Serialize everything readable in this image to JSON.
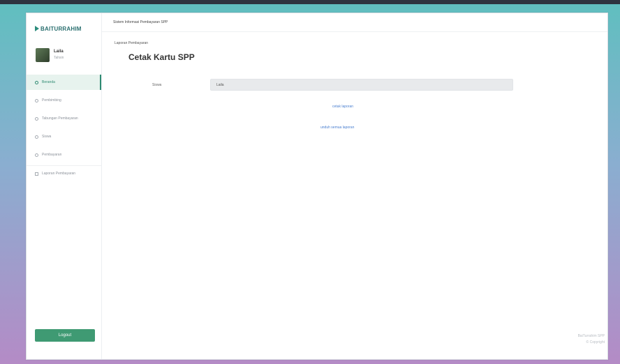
{
  "brand": {
    "name": "BAITURRAHIM"
  },
  "profile": {
    "name": "Laila",
    "role": "Tahsin"
  },
  "sidebar": {
    "items": [
      {
        "label": "Beranda",
        "icon": "home-icon"
      },
      {
        "label": "Pembimbing",
        "icon": "user-icon"
      },
      {
        "label": "Tabungan Pembayaran",
        "icon": "wallet-icon"
      },
      {
        "label": "Siswa",
        "icon": "users-icon"
      },
      {
        "label": "Pembayaran",
        "icon": "receipt-icon"
      },
      {
        "label": "Laporan Pembayaran",
        "icon": "report-icon"
      }
    ],
    "active_index": 0,
    "logout_label": "Logout"
  },
  "header": {
    "app_title": "Sistem Informasi Pembayaran SPP"
  },
  "main": {
    "section_title": "Laporan Pembayaran",
    "page_title": "Cetak Kartu SPP",
    "field_label": "Siswa",
    "field_value": "Laila",
    "link_print": "cetak laporan",
    "link_download": "unduh semua laporan"
  },
  "footer": {
    "line1": "BaiTurrahim SPP",
    "line2": "© Copyright"
  },
  "colors": {
    "accent": "#3f9a73",
    "link": "#4a7fd0",
    "brand": "#2a6f6f"
  }
}
